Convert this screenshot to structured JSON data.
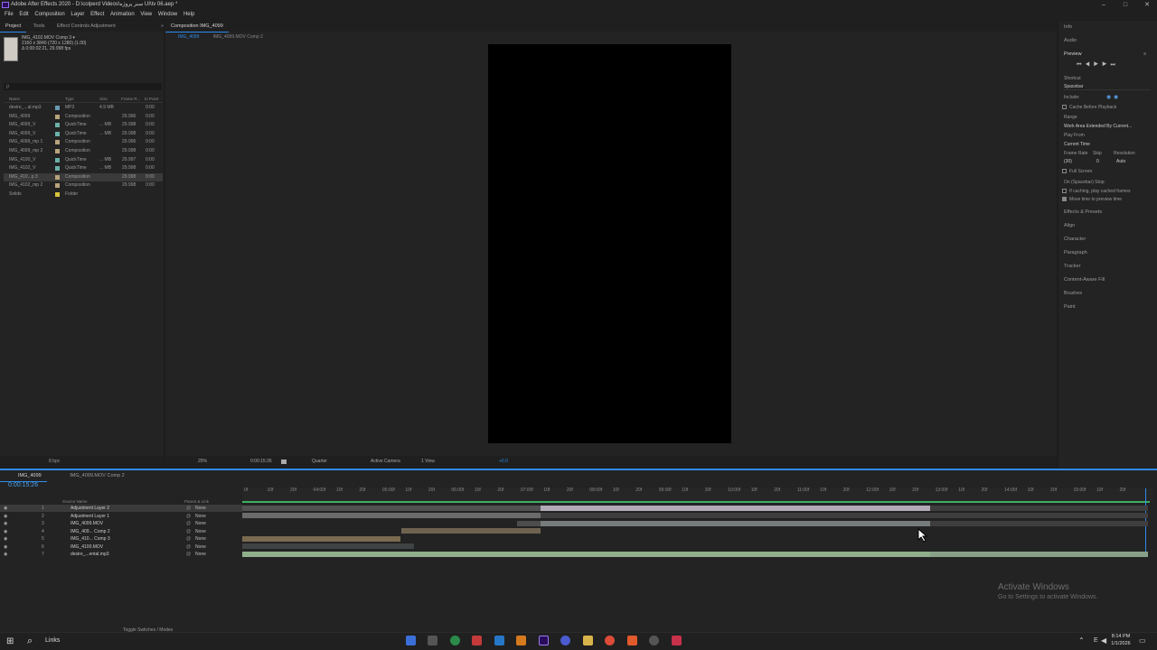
{
  "window": {
    "title": "Adobe After Effects 2020 - D:\\colperd Videos\\سبز پروژه UI\\tv 06.aep *"
  },
  "menu": [
    "File",
    "Edit",
    "Composition",
    "Layer",
    "Effect",
    "Animation",
    "View",
    "Window",
    "Help"
  ],
  "project": {
    "tabs": [
      "Project",
      "Tools",
      "Effect Controls Adjustment"
    ],
    "thumb_info": [
      "IMG_4102.MOV Comp 3 ▾",
      "2160 x 3840 (720 x 1280) (1.00)",
      "Δ 0:00:02:21, 29.998 fps"
    ],
    "search_placeholder": "ρ",
    "columns": [
      "Name",
      "Type",
      "Size",
      "Frame R...",
      "In Point"
    ],
    "items": [
      {
        "name": "desire_...al.mp3",
        "type": "MP3",
        "size": "4.9 MB",
        "fps": "",
        "in": "0:00",
        "color": "#6a9ab0"
      },
      {
        "name": "IMG_4099",
        "type": "Composition",
        "size": "",
        "fps": "29.996",
        "in": "0:00",
        "color": "#b8a47c"
      },
      {
        "name": "IMG_4099_V",
        "type": "QuickTime",
        "size": "... MB",
        "fps": "29.998",
        "in": "0:00",
        "color": "#6ab0a8"
      },
      {
        "name": "IMG_4099_V",
        "type": "QuickTime",
        "size": "... MB",
        "fps": "29.998",
        "in": "0:00",
        "color": "#6ab0a8"
      },
      {
        "name": "IMG_4099_mp 1",
        "type": "Composition",
        "size": "",
        "fps": "29.996",
        "in": "0:00",
        "color": "#b8a47c"
      },
      {
        "name": "IMG_4099_mp 2",
        "type": "Composition",
        "size": "",
        "fps": "29.998",
        "in": "0:00",
        "color": "#b8a47c"
      },
      {
        "name": "IMG_4100_V",
        "type": "QuickTime",
        "size": "... MB",
        "fps": "29.997",
        "in": "0:00",
        "color": "#6ab0a8"
      },
      {
        "name": "IMG_4102_V",
        "type": "QuickTime",
        "size": "... MB",
        "fps": "29.998",
        "in": "0:00",
        "color": "#6ab0a8"
      },
      {
        "name": "IMG_410...p 3",
        "type": "Composition",
        "size": "",
        "fps": "29.998",
        "in": "0:00",
        "color": "#b8a47c"
      },
      {
        "name": "IMG_4102_mp 2",
        "type": "Composition",
        "size": "",
        "fps": "29.998",
        "in": "0:00",
        "color": "#b8a47c"
      },
      {
        "name": "Solids",
        "type": "Folder",
        "size": "",
        "fps": "",
        "in": "",
        "color": "#d8c13a"
      }
    ],
    "footer": "8 bpc"
  },
  "viewer": {
    "tabs": [
      "Composition IMG_4099"
    ],
    "subtabs": [
      "IMG_4099",
      "IMG_4099.MOV Comp 2"
    ],
    "toolbar": {
      "zoom": "25%",
      "timecode": "0:00:15:26",
      "resolution": "Quarter",
      "camera": "Active Camera",
      "views": "1 View",
      "exposure": "+0.0"
    }
  },
  "right_panel": {
    "info": "Info",
    "audio": "Audio",
    "preview": "Preview",
    "shortcut_label": "Shortcut",
    "shortcut_value": "Spacebar",
    "include_label": "Include:",
    "cache_label": "Cache Before Playback",
    "range_label": "Range",
    "range_value": "Work Area Extended By Current...",
    "playfrom_label": "Play From",
    "playfrom_value": "Current Time",
    "framerate_label": "Frame Rate",
    "skip_label": "Skip",
    "resolution_label": "Resolution",
    "framerate_value": "(30)",
    "skip_value": "0",
    "resolution_value": "Auto",
    "fullscreen_label": "Full Screen",
    "stop_label": "On (Spacebar) Stop:",
    "stop_opt1": "If caching, play cached frames",
    "stop_opt2": "Move time to preview time",
    "panels": [
      "Effects & Presets",
      "Align",
      "Character",
      "Paragraph",
      "Tracker",
      "Content-Aware Fill",
      "Brushes",
      "Paint"
    ]
  },
  "timeline": {
    "tabs": [
      "IMG_4099",
      "IMG_4099.MOV Comp 2"
    ],
    "timecode": "0:00:15:26",
    "col_source": "Source Name",
    "col_parent": "Parent & Link",
    "layers": [
      {
        "num": "1",
        "name": "Adjustment Layer 2",
        "parent": "None",
        "selected": true
      },
      {
        "num": "2",
        "name": "Adjustment Layer 1",
        "parent": "None",
        "selected": false
      },
      {
        "num": "3",
        "name": "IMG_4099.MOV",
        "parent": "None",
        "selected": false
      },
      {
        "num": "4",
        "name": "IMG_409... Comp 2",
        "parent": "None",
        "selected": false
      },
      {
        "num": "5",
        "name": "IMG_410... Comp 3",
        "parent": "None",
        "selected": false
      },
      {
        "num": "6",
        "name": "IMG_4100.MOV",
        "parent": "None",
        "selected": false
      },
      {
        "num": "7",
        "name": "desire_...ental.mp3",
        "parent": "None",
        "selected": false
      }
    ],
    "ruler": [
      "0f",
      "10f",
      "20f",
      "04:00f",
      "10f",
      "20f",
      "05:00f",
      "10f",
      "20f",
      "06:00f",
      "10f",
      "20f",
      "07:00f",
      "10f",
      "20f",
      "08:00f",
      "10f",
      "20f",
      "09:00f",
      "10f",
      "20f",
      "10:00f",
      "10f",
      "20f",
      "11:00f",
      "10f",
      "20f",
      "12:00f",
      "10f",
      "20f",
      "13:00f",
      "10f",
      "20f",
      "14:00f",
      "10f",
      "20f",
      "15:00f",
      "10f",
      "20f"
    ],
    "toggle_label": "Toggle Switches / Modes"
  },
  "watermark": {
    "title": "Activate Windows",
    "subtitle": "Go to Settings to activate Windows."
  },
  "taskbar": {
    "search_label": "Links",
    "time": "8:14 PM",
    "date": "1/1/2026",
    "lang": "E"
  }
}
